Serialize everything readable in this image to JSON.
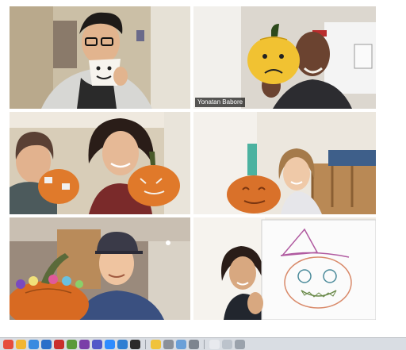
{
  "gallery": {
    "participants": [
      {
        "id": "p1",
        "name": "",
        "active": false
      },
      {
        "id": "p2",
        "name": "Yonatan Babore",
        "active": true
      },
      {
        "id": "p3",
        "name": "",
        "active": false
      },
      {
        "id": "p4",
        "name": "",
        "active": false
      },
      {
        "id": "p5",
        "name": "",
        "active": false
      },
      {
        "id": "p6",
        "name": "",
        "active": false
      }
    ]
  },
  "taskbar": {
    "icons": [
      {
        "name": "finder-icon",
        "color": "#e64d3c"
      },
      {
        "name": "chrome-icon",
        "color": "#f2b632"
      },
      {
        "name": "safari-icon",
        "color": "#3a8be0"
      },
      {
        "name": "vscode-icon",
        "color": "#2a6fc9"
      },
      {
        "name": "mail-icon",
        "color": "#c9302c"
      },
      {
        "name": "slack-icon",
        "color": "#5b9a3a"
      },
      {
        "name": "onenote-icon",
        "color": "#7a3fa8"
      },
      {
        "name": "teams-icon",
        "color": "#5159c8"
      },
      {
        "name": "zoom-icon",
        "color": "#2d8cff"
      },
      {
        "name": "calendar-icon",
        "color": "#2f7fd2"
      },
      {
        "name": "terminal-icon",
        "color": "#2b2b2b"
      },
      {
        "name": "notes-icon",
        "color": "#f0c33c"
      },
      {
        "name": "disk-icon",
        "color": "#8a9099"
      },
      {
        "name": "preview-icon",
        "color": "#6aa0d8"
      },
      {
        "name": "settings-icon",
        "color": "#7d858f"
      },
      {
        "name": "document-icon",
        "color": "#e8eaee"
      },
      {
        "name": "folder-icon",
        "color": "#bcc3cc"
      },
      {
        "name": "trash-icon",
        "color": "#9aa2ac"
      }
    ]
  }
}
